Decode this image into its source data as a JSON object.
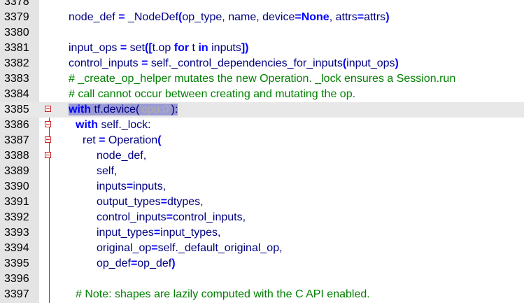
{
  "lines": [
    {
      "num": "3378",
      "segments": []
    },
    {
      "num": "3379",
      "segments": [
        {
          "k": "id",
          "t": "node_def "
        },
        {
          "k": "op",
          "t": "="
        },
        {
          "k": "id",
          "t": " _NodeDef"
        },
        {
          "k": "op",
          "t": "("
        },
        {
          "k": "id",
          "t": "op_type, name, device"
        },
        {
          "k": "op",
          "t": "="
        },
        {
          "k": "kw",
          "t": "None"
        },
        {
          "k": "id",
          "t": ", attrs"
        },
        {
          "k": "op",
          "t": "="
        },
        {
          "k": "id",
          "t": "attrs"
        },
        {
          "k": "op",
          "t": ")"
        }
      ]
    },
    {
      "num": "3380",
      "segments": []
    },
    {
      "num": "3381",
      "segments": [
        {
          "k": "id",
          "t": "input_ops "
        },
        {
          "k": "op",
          "t": "="
        },
        {
          "k": "id",
          "t": " set"
        },
        {
          "k": "op",
          "t": "(["
        },
        {
          "k": "id",
          "t": "t.op "
        },
        {
          "k": "kw",
          "t": "for"
        },
        {
          "k": "id",
          "t": " t "
        },
        {
          "k": "kw",
          "t": "in"
        },
        {
          "k": "id",
          "t": " inputs"
        },
        {
          "k": "op",
          "t": "])"
        }
      ]
    },
    {
      "num": "3382",
      "segments": [
        {
          "k": "id",
          "t": "control_inputs "
        },
        {
          "k": "op",
          "t": "="
        },
        {
          "k": "id",
          "t": " self._control_dependencies_for_inputs"
        },
        {
          "k": "op",
          "t": "("
        },
        {
          "k": "id",
          "t": "input_ops"
        },
        {
          "k": "op",
          "t": ")"
        }
      ]
    },
    {
      "num": "3383",
      "segments": [
        {
          "k": "cm",
          "t": "# _create_op_helper mutates the new Operation. _lock ensures a Session.run"
        }
      ]
    },
    {
      "num": "3384",
      "segments": [
        {
          "k": "cm",
          "t": "# call cannot occur between creating and mutating the op."
        }
      ]
    },
    {
      "num": "3385",
      "segments": [
        {
          "k": "selkw",
          "t": "with"
        },
        {
          "k": "sel",
          "t": " tf.device("
        },
        {
          "k": "selstr",
          "t": "'cpu:0'"
        },
        {
          "k": "sel",
          "t": "):"
        }
      ]
    },
    {
      "num": "3386",
      "segments": [
        {
          "k": "kw",
          "t": "with"
        },
        {
          "k": "id",
          "t": " self._lock:"
        }
      ]
    },
    {
      "num": "3387",
      "segments": [
        {
          "k": "id",
          "t": "ret "
        },
        {
          "k": "op",
          "t": "="
        },
        {
          "k": "id",
          "t": " Operation"
        },
        {
          "k": "op",
          "t": "("
        }
      ]
    },
    {
      "num": "3388",
      "segments": [
        {
          "k": "id",
          "t": "node_def,"
        }
      ]
    },
    {
      "num": "3389",
      "segments": [
        {
          "k": "id",
          "t": "self,"
        }
      ]
    },
    {
      "num": "3390",
      "segments": [
        {
          "k": "id",
          "t": "inputs"
        },
        {
          "k": "op",
          "t": "="
        },
        {
          "k": "id",
          "t": "inputs,"
        }
      ]
    },
    {
      "num": "3391",
      "segments": [
        {
          "k": "id",
          "t": "output_types"
        },
        {
          "k": "op",
          "t": "="
        },
        {
          "k": "id",
          "t": "dtypes,"
        }
      ]
    },
    {
      "num": "3392",
      "segments": [
        {
          "k": "id",
          "t": "control_inputs"
        },
        {
          "k": "op",
          "t": "="
        },
        {
          "k": "id",
          "t": "control_inputs,"
        }
      ]
    },
    {
      "num": "3393",
      "segments": [
        {
          "k": "id",
          "t": "input_types"
        },
        {
          "k": "op",
          "t": "="
        },
        {
          "k": "id",
          "t": "input_types,"
        }
      ]
    },
    {
      "num": "3394",
      "segments": [
        {
          "k": "id",
          "t": "original_op"
        },
        {
          "k": "op",
          "t": "="
        },
        {
          "k": "id",
          "t": "self._default_original_op,"
        }
      ]
    },
    {
      "num": "3395",
      "segments": [
        {
          "k": "id",
          "t": "op_def"
        },
        {
          "k": "op",
          "t": "="
        },
        {
          "k": "id",
          "t": "op_def"
        },
        {
          "k": "op",
          "t": ")"
        }
      ]
    },
    {
      "num": "3396",
      "segments": []
    },
    {
      "num": "3397",
      "segments": [
        {
          "k": "cm",
          "t": "# Note: shapes are lazily computed with the C API enabled."
        }
      ]
    }
  ]
}
